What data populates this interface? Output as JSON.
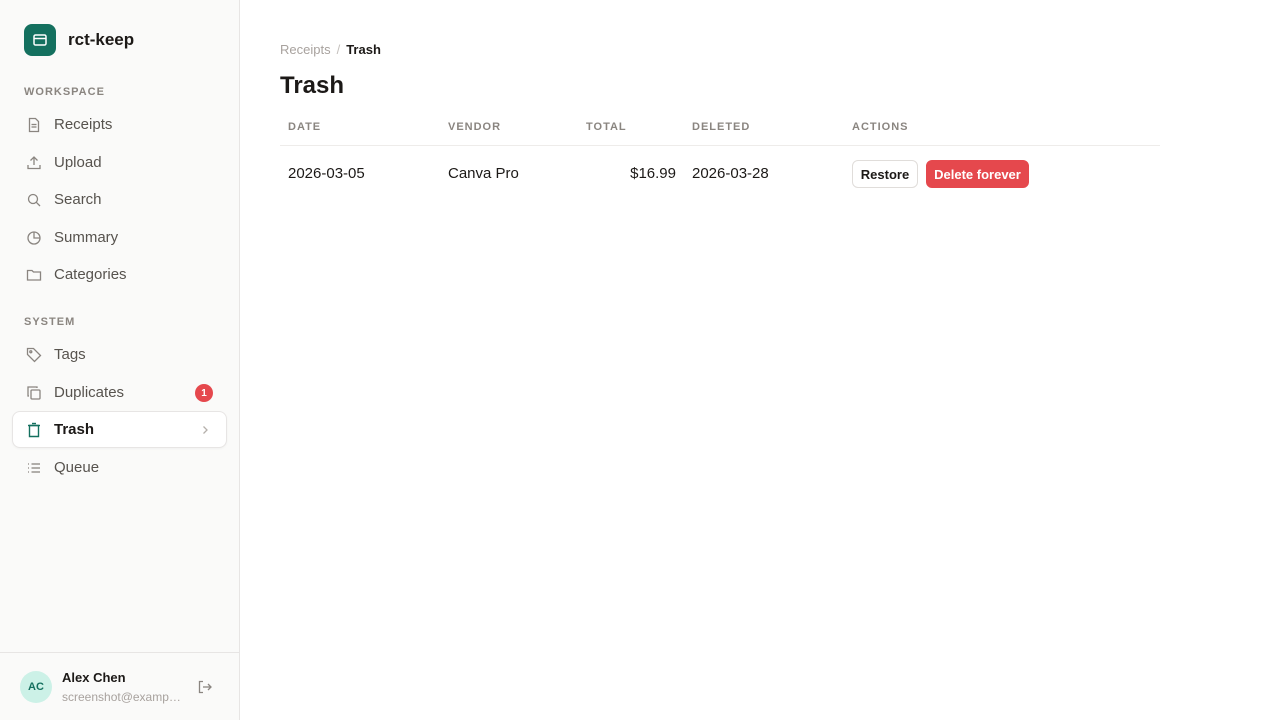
{
  "app": {
    "name": "rct-keep",
    "accent": "#14705f"
  },
  "sidebar": {
    "sections": [
      {
        "label": "WORKSPACE"
      },
      {
        "label": "SYSTEM"
      }
    ],
    "items": [
      {
        "label": "Receipts",
        "icon": "receipt-icon"
      },
      {
        "label": "Upload",
        "icon": "upload-icon"
      },
      {
        "label": "Search",
        "icon": "search-icon"
      },
      {
        "label": "Summary",
        "icon": "pie-chart-icon"
      },
      {
        "label": "Categories",
        "icon": "folder-icon"
      },
      {
        "label": "Tags",
        "icon": "tag-icon"
      },
      {
        "label": "Duplicates",
        "icon": "copy-icon",
        "badge": "1"
      },
      {
        "label": "Trash",
        "icon": "trash-icon",
        "active": true
      },
      {
        "label": "Queue",
        "icon": "list-icon"
      }
    ]
  },
  "user": {
    "initials": "AC",
    "name": "Alex Chen",
    "email": "screenshot@example.com"
  },
  "breadcrumb": {
    "parent": "Receipts",
    "separator": "/",
    "current": "Trash"
  },
  "page": {
    "title": "Trash"
  },
  "table": {
    "headers": {
      "date": "DATE",
      "vendor": "VENDOR",
      "total": "TOTAL",
      "deleted": "DELETED",
      "actions": "ACTIONS"
    },
    "rows": [
      {
        "date": "2026-03-05",
        "vendor": "Canva Pro",
        "total": "$16.99",
        "deleted": "2026-03-28",
        "restore_label": "Restore",
        "delete_label": "Delete forever"
      }
    ]
  },
  "colors": {
    "danger": "#e5484d",
    "avatar_bg": "#ccf1e7"
  }
}
